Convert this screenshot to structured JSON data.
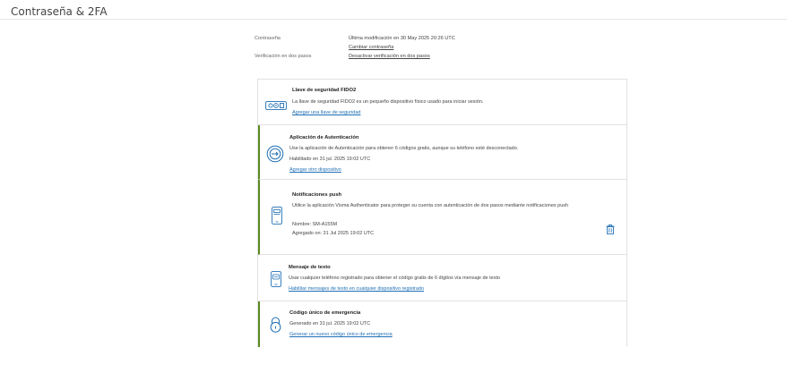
{
  "page": {
    "title": "Contraseña & 2FA"
  },
  "summary": {
    "password_label": "Contraseña",
    "last_modified": "Última modificación en 30 May 2025 20:26 UTC",
    "change_password": "Cambiar contraseña",
    "two_step_label": "Verificación en dos pasos",
    "disable_two_step": "Desactivar verificación en dos pasos"
  },
  "methods": {
    "fido": {
      "title": "Llave de seguridad FIDO2",
      "description": "La llave de seguridad FIDO2 es un pequeño dispositivo físico usado para iniciar sesión.",
      "link": "Agregar una llave de seguridad",
      "icon": "fido-key-icon"
    },
    "authenticator": {
      "title": "Aplicación de Autenticación",
      "description": "Use la aplicación de Autenticación para obtener 6 códigos gratis, aunque su teléfono esté desconectado.",
      "status": "Habilitado en 31 jul. 2025 19:02 UTC",
      "link": "Agregar otro dispositivo",
      "icon": "authenticator-app-icon"
    },
    "push": {
      "title": "Notificaciones push",
      "description": "Utilice la aplicación Visma Authenticator para proteger su cuenta con autenticación de dos pasos mediante notificaciones push",
      "device_name": "Nombre: SM-A155M",
      "added_on": "Agregado on: 31 Jul 2025 19:02 UTC",
      "icon": "mobile-phone-icon"
    },
    "sms": {
      "title": "Mensaje de texto",
      "description": "Usar cualquier teléfono registrado para obtener el código gratis de 6 dígitos vía mensaje de texto",
      "link": "Habilitar mensajes de texto en cualquier dispositivo registrado",
      "icon": "sms-phone-icon"
    },
    "emergency": {
      "title": "Código único de emergencia",
      "status": "Generado en 31 jul. 2025 19:02 UTC",
      "link": "Generar un nuevo código único de emergencia",
      "icon": "padlock-icon"
    }
  },
  "colors": {
    "accent_bar": "#5a8b1f",
    "link": "#1f6fb5",
    "icon": "#1f6fb5"
  }
}
